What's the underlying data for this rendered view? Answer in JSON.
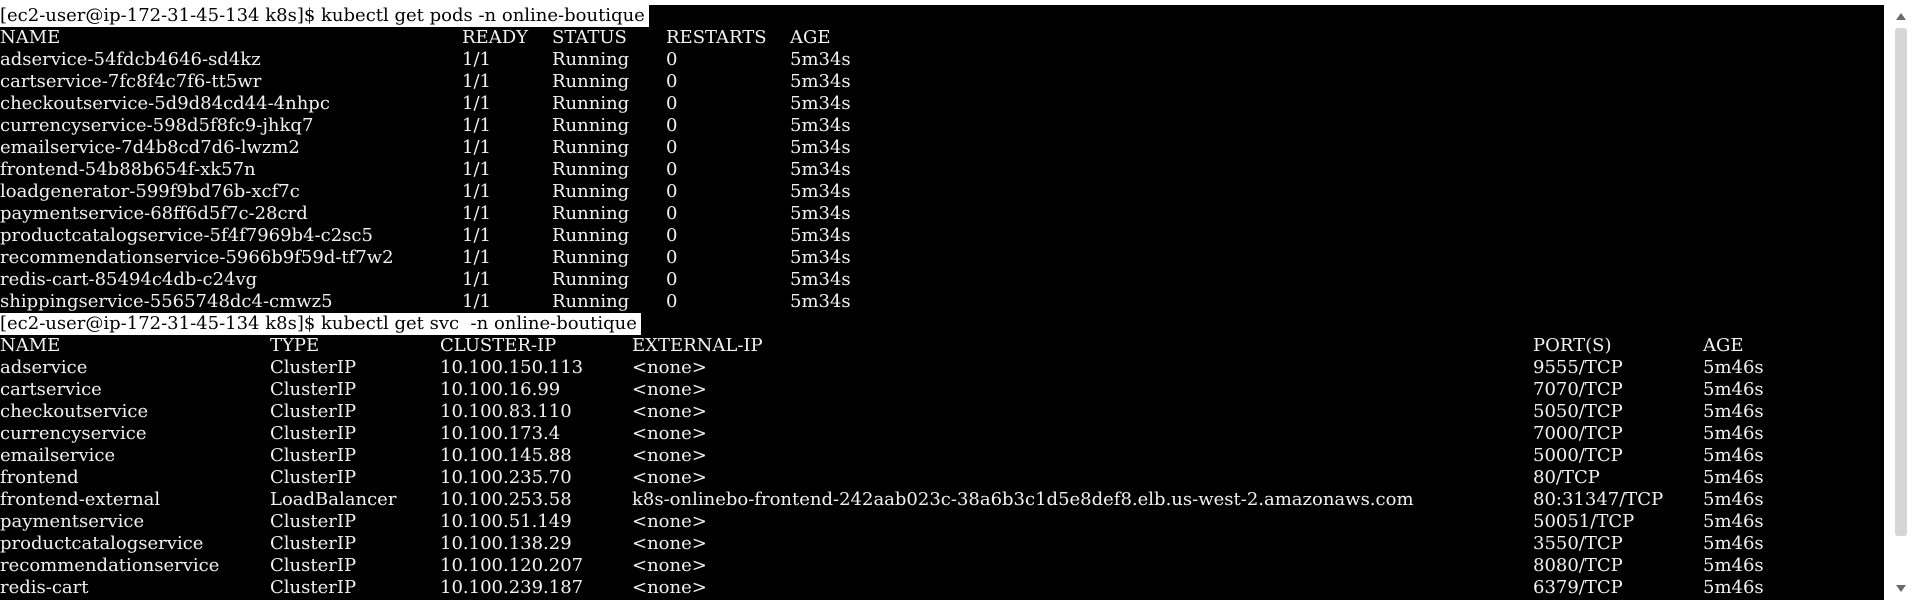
{
  "terminal": {
    "prompt1": "[ec2-user@ip-172-31-45-134 k8s]$ kubectl get pods -n online-boutique",
    "pods_header": [
      "NAME",
      "READY",
      "STATUS",
      "RESTARTS",
      "AGE"
    ],
    "pods": [
      [
        "adservice-54fdcb4646-sd4kz",
        "1/1",
        "Running",
        "0",
        "5m34s"
      ],
      [
        "cartservice-7fc8f4c7f6-tt5wr",
        "1/1",
        "Running",
        "0",
        "5m34s"
      ],
      [
        "checkoutservice-5d9d84cd44-4nhpc",
        "1/1",
        "Running",
        "0",
        "5m34s"
      ],
      [
        "currencyservice-598d5f8fc9-jhkq7",
        "1/1",
        "Running",
        "0",
        "5m34s"
      ],
      [
        "emailservice-7d4b8cd7d6-lwzm2",
        "1/1",
        "Running",
        "0",
        "5m34s"
      ],
      [
        "frontend-54b88b654f-xk57n",
        "1/1",
        "Running",
        "0",
        "5m34s"
      ],
      [
        "loadgenerator-599f9bd76b-xcf7c",
        "1/1",
        "Running",
        "0",
        "5m34s"
      ],
      [
        "paymentservice-68ff6d5f7c-28crd",
        "1/1",
        "Running",
        "0",
        "5m34s"
      ],
      [
        "productcatalogservice-5f4f7969b4-c2sc5",
        "1/1",
        "Running",
        "0",
        "5m34s"
      ],
      [
        "recommendationservice-5966b9f59d-tf7w2",
        "1/1",
        "Running",
        "0",
        "5m34s"
      ],
      [
        "redis-cart-85494c4db-c24vg",
        "1/1",
        "Running",
        "0",
        "5m34s"
      ],
      [
        "shippingservice-5565748dc4-cmwz5",
        "1/1",
        "Running",
        "0",
        "5m34s"
      ]
    ],
    "prompt2": "[ec2-user@ip-172-31-45-134 k8s]$ kubectl get svc  -n online-boutique",
    "svc_header": [
      "NAME",
      "TYPE",
      "CLUSTER-IP",
      "EXTERNAL-IP",
      "PORT(S)",
      "AGE"
    ],
    "services": [
      [
        "adservice",
        "ClusterIP",
        "10.100.150.113",
        "<none>",
        "9555/TCP",
        "5m46s"
      ],
      [
        "cartservice",
        "ClusterIP",
        "10.100.16.99",
        "<none>",
        "7070/TCP",
        "5m46s"
      ],
      [
        "checkoutservice",
        "ClusterIP",
        "10.100.83.110",
        "<none>",
        "5050/TCP",
        "5m46s"
      ],
      [
        "currencyservice",
        "ClusterIP",
        "10.100.173.4",
        "<none>",
        "7000/TCP",
        "5m46s"
      ],
      [
        "emailservice",
        "ClusterIP",
        "10.100.145.88",
        "<none>",
        "5000/TCP",
        "5m46s"
      ],
      [
        "frontend",
        "ClusterIP",
        "10.100.235.70",
        "<none>",
        "80/TCP",
        "5m46s"
      ],
      [
        "frontend-external",
        "LoadBalancer",
        "10.100.253.58",
        "k8s-onlinebo-frontend-242aab023c-38a6b3c1d5e8def8.elb.us-west-2.amazonaws.com",
        "80:31347/TCP",
        "5m46s"
      ],
      [
        "paymentservice",
        "ClusterIP",
        "10.100.51.149",
        "<none>",
        "50051/TCP",
        "5m46s"
      ],
      [
        "productcatalogservice",
        "ClusterIP",
        "10.100.138.29",
        "<none>",
        "3550/TCP",
        "5m46s"
      ],
      [
        "recommendationservice",
        "ClusterIP",
        "10.100.120.207",
        "<none>",
        "8080/TCP",
        "5m46s"
      ],
      [
        "redis-cart",
        "ClusterIP",
        "10.100.239.187",
        "<none>",
        "6379/TCP",
        "5m46s"
      ]
    ]
  },
  "colors": {
    "background": "#000000",
    "foreground": "#f2f2f2",
    "prompt_background": "#ffffff",
    "prompt_foreground": "#000000",
    "scrollbar_thumb": "#d6d6d6"
  },
  "icons": {
    "scroll_up": "scroll-up-arrow-icon",
    "scroll_down": "scroll-down-arrow-icon"
  }
}
